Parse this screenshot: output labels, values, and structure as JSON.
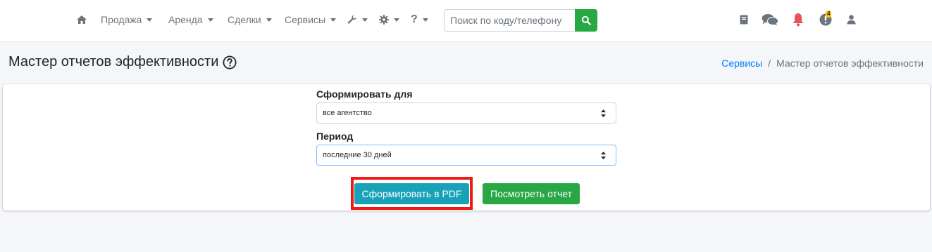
{
  "navbar": {
    "home_icon": "home-icon",
    "menu": [
      {
        "label": "Продажа",
        "has_caret": true
      },
      {
        "label": "Аренда",
        "has_caret": true
      },
      {
        "label": "Сделки",
        "has_caret": true
      },
      {
        "label": "Сервисы",
        "has_caret": true
      }
    ],
    "icon_menus": [
      "wrench-icon",
      "gear-icon",
      "question-icon"
    ],
    "search": {
      "placeholder": "Поиск по коду/телефону",
      "button_icon": "search-icon"
    },
    "right_icons": [
      "book-icon",
      "comments-icon",
      "bell-icon",
      "alert-icon",
      "user-icon"
    ],
    "alert_badge": "4"
  },
  "header": {
    "title": "Мастер отчетов эффективности",
    "help_icon": "question-circle-icon",
    "breadcrumb": {
      "link": "Сервисы",
      "separator": "/",
      "current": "Мастер отчетов эффективности"
    }
  },
  "form": {
    "for_label": "Сформировать для",
    "for_value": "все агентство",
    "period_label": "Период",
    "period_value": "последние 30 дней",
    "pdf_button": "Сформировать в PDF",
    "view_button": "Посмотреть отчет"
  },
  "colors": {
    "info": "#17a2b8",
    "success": "#28a745",
    "link": "#007bff",
    "highlight": "#ee1c10",
    "bell": "#e8505b",
    "badge": "#ffc107"
  }
}
